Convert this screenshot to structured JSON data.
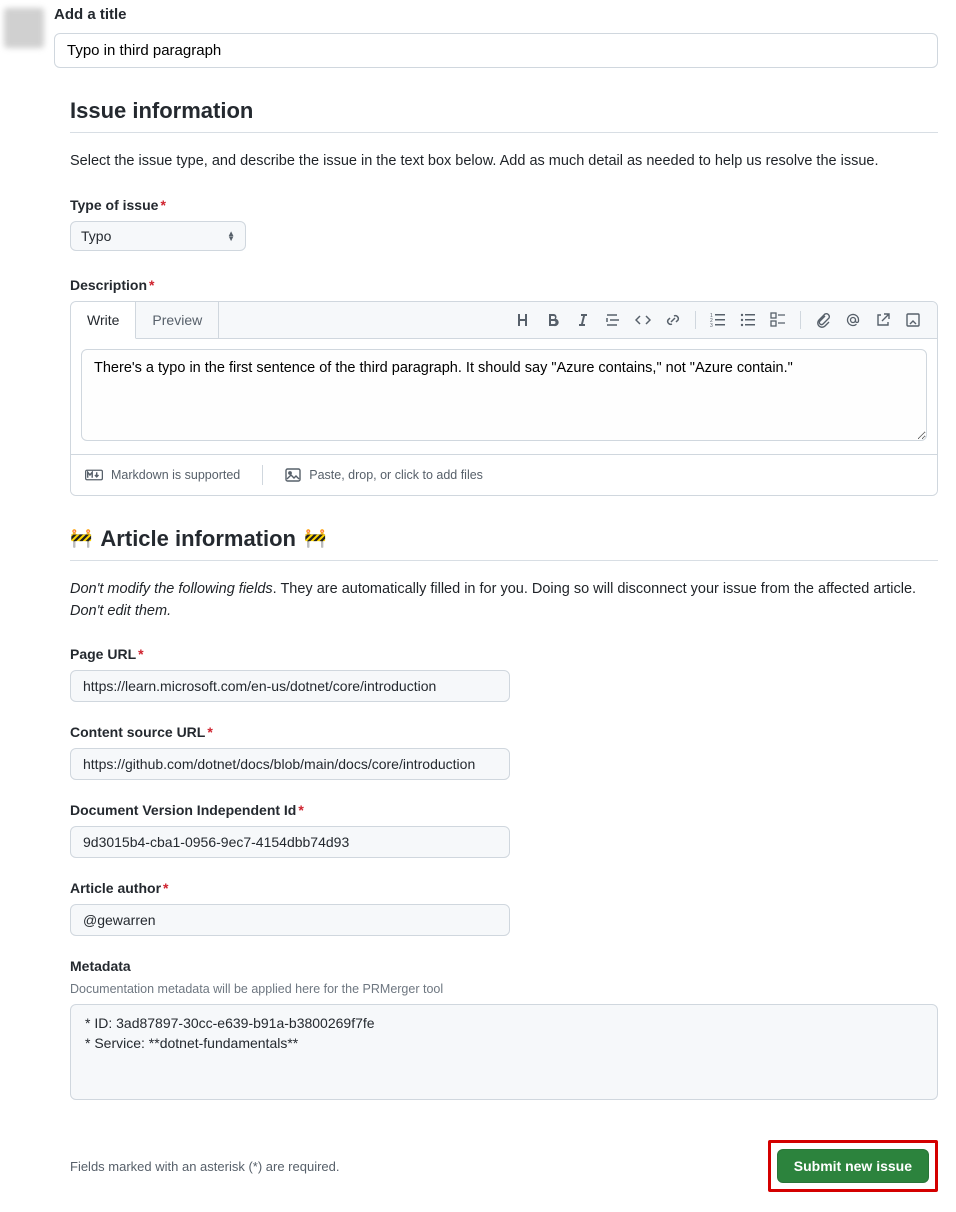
{
  "title_section": {
    "label": "Add a title",
    "value": "Typo in third paragraph"
  },
  "issue_info": {
    "heading": "Issue information",
    "description": "Select the issue type, and describe the issue in the text box below. Add as much detail as needed to help us resolve the issue.",
    "type_label": "Type of issue",
    "type_value": "Typo",
    "desc_label": "Description",
    "tabs": {
      "write": "Write",
      "preview": "Preview"
    },
    "body_text": "There's a typo in the first sentence of the third paragraph. It should say \"Azure contains,\" not \"Azure contain.\"",
    "footer": {
      "markdown": "Markdown is supported",
      "attach": "Paste, drop, or click to add files"
    }
  },
  "article_info": {
    "heading": "Article information",
    "note_italic1": "Don't modify the following fields",
    "note_rest": ". They are automatically filled in for you. Doing so will disconnect your issue from the affected article. ",
    "note_italic2": "Don't edit them.",
    "page_url_label": "Page URL",
    "page_url_value": "https://learn.microsoft.com/en-us/dotnet/core/introduction",
    "content_src_label": "Content source URL",
    "content_src_value": "https://github.com/dotnet/docs/blob/main/docs/core/introduction",
    "doc_id_label": "Document Version Independent Id",
    "doc_id_value": "9d3015b4-cba1-0956-9ec7-4154dbb74d93",
    "author_label": "Article author",
    "author_value": "@gewarren",
    "metadata_label": "Metadata",
    "metadata_hint": "Documentation metadata will be applied here for the PRMerger tool",
    "metadata_lines": [
      "* ID: 3ad87897-30cc-e639-b91a-b3800269f7fe",
      "* Service: **dotnet-fundamentals**"
    ]
  },
  "bottom": {
    "note": "Fields marked with an asterisk (*) are required.",
    "submit": "Submit new issue"
  }
}
